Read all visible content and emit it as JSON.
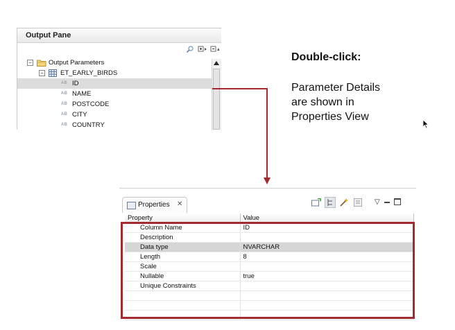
{
  "output_pane": {
    "title": "Output Pane",
    "tree": {
      "root_label": "Output Parameters",
      "table_label": "ET_EARLY_BIRDS",
      "columns": [
        "ID",
        "NAME",
        "POSTCODE",
        "CITY",
        "COUNTRY"
      ],
      "selected_column": "ID"
    },
    "column_type_icon": "AB"
  },
  "callout": {
    "title": "Double-click:",
    "lines": [
      "Parameter Details",
      "are shown in",
      "Properties View"
    ]
  },
  "properties_view": {
    "tab_label": "Properties",
    "header": {
      "property": "Property",
      "value": "Value"
    },
    "rows": [
      {
        "property": "Column Name",
        "value": "ID"
      },
      {
        "property": "Description",
        "value": ""
      },
      {
        "property": "Data type",
        "value": "NVARCHAR"
      },
      {
        "property": "Length",
        "value": "8"
      },
      {
        "property": "Scale",
        "value": ""
      },
      {
        "property": "Nullable",
        "value": "true"
      },
      {
        "property": "Unique Constraints",
        "value": ""
      },
      {
        "property": "",
        "value": ""
      },
      {
        "property": "",
        "value": ""
      },
      {
        "property": "",
        "value": ""
      }
    ],
    "selected_row": 2
  },
  "colors": {
    "highlight": "#a32a2e",
    "selection": "#d6d6d6"
  }
}
